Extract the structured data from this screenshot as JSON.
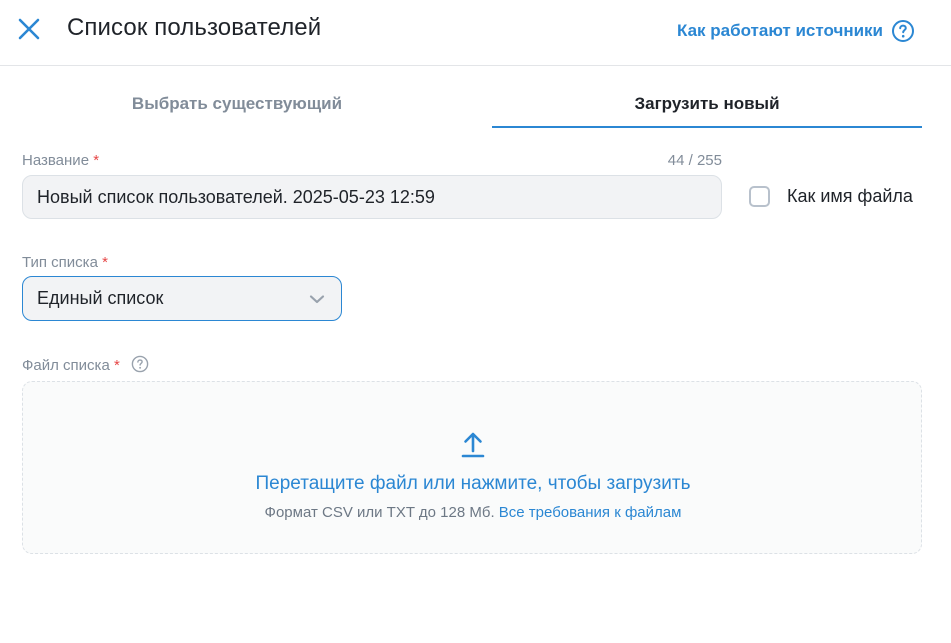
{
  "header": {
    "title": "Список пользователей",
    "help_link": "Как работают источники",
    "close_icon": "close-icon",
    "help_icon": "question-circle-icon"
  },
  "tabs": [
    {
      "label": "Выбрать существующий",
      "active": false
    },
    {
      "label": "Загрузить новый",
      "active": true
    }
  ],
  "name_field": {
    "label": "Название",
    "required_mark": "*",
    "value": "Новый список пользователей. 2025-05-23 12:59",
    "counter": "44 / 255"
  },
  "filename_checkbox": {
    "label": "Как имя файла",
    "checked": false
  },
  "list_type": {
    "label": "Тип списка",
    "required_mark": "*",
    "value": "Единый список"
  },
  "file_field": {
    "label": "Файл списка",
    "required_mark": "*",
    "drop_title": "Перетащите файл или нажмите, чтобы загрузить",
    "hint": "Формат CSV или TXT до 128 Мб.",
    "requirements_link": "Все требования к файлам"
  },
  "colors": {
    "accent": "#2b87d3",
    "muted": "#818c99",
    "required": "#e64646",
    "input_bg": "#f2f3f5"
  }
}
